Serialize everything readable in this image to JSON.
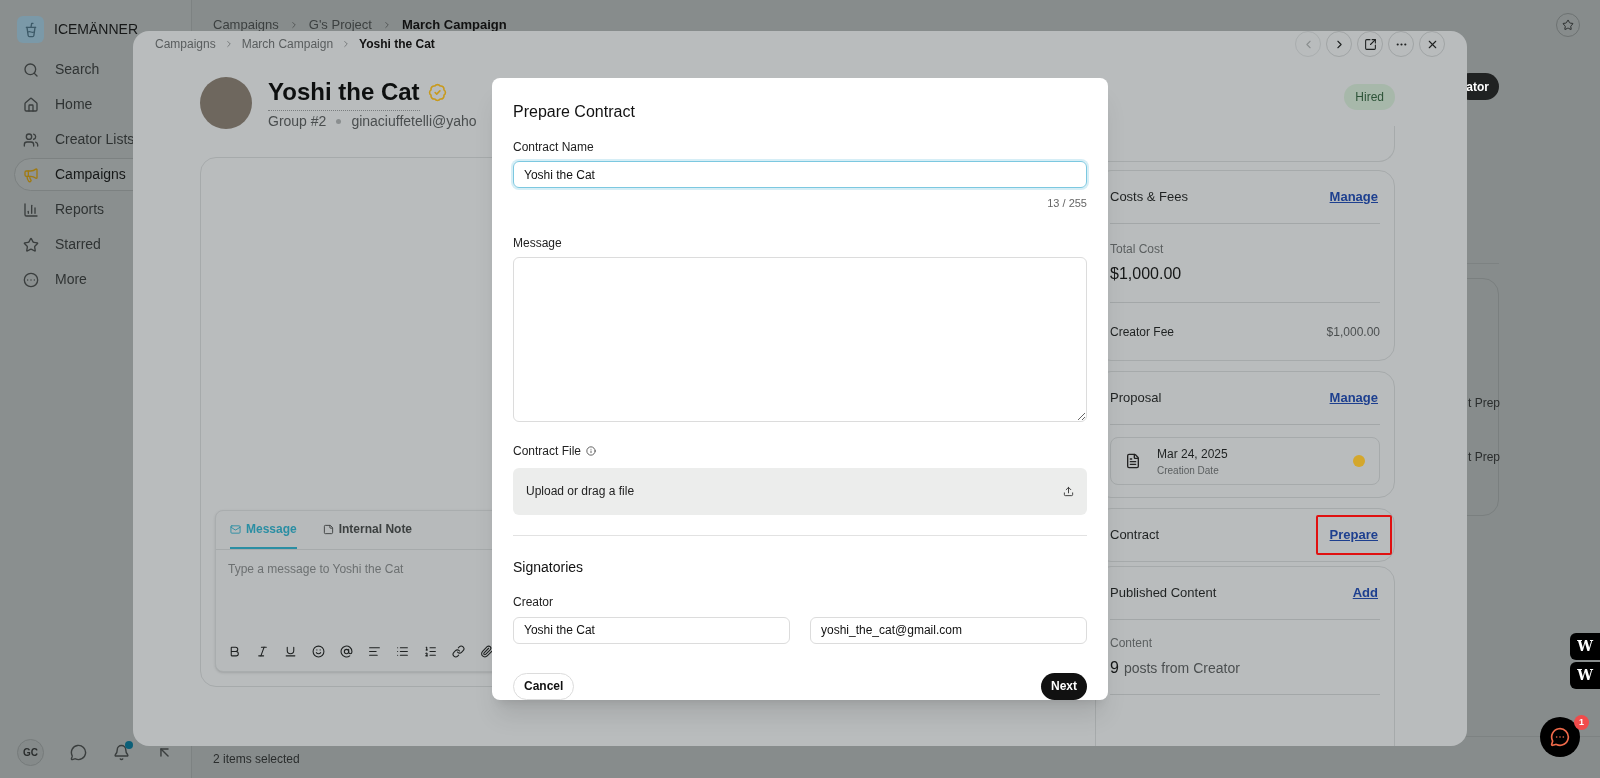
{
  "app": {
    "brand": "ICEMÄNNER",
    "nav": [
      {
        "label": "Search",
        "selected": false
      },
      {
        "label": "Home",
        "selected": false
      },
      {
        "label": "Creator Lists",
        "selected": false
      },
      {
        "label": "Campaigns",
        "selected": true
      },
      {
        "label": "Reports",
        "selected": false
      },
      {
        "label": "Starred",
        "selected": false
      },
      {
        "label": "More",
        "selected": false
      }
    ],
    "user_initials": "GC",
    "has_notification": true,
    "breadcrumbs": [
      "Campaigns",
      "G's Project",
      "March Campaign"
    ],
    "header_button": "ator",
    "background_rows": [
      "t Prep",
      "t Prep"
    ],
    "footer_text": "2 items selected",
    "side_widgets": [
      "W",
      "W"
    ],
    "chat_badge": "1"
  },
  "drawer": {
    "breadcrumbs": [
      "Campaigns",
      "March Campaign",
      "Yoshi the Cat"
    ],
    "name": "Yoshi the Cat",
    "verified": true,
    "group": "Group #2",
    "email": "ginaciuffetelli@yaho",
    "status": "Hired",
    "composer": {
      "tabs": [
        {
          "label": "Message",
          "selected": true
        },
        {
          "label": "Internal Note",
          "selected": false
        }
      ],
      "placeholder": "Type a message to Yoshi the Cat"
    },
    "sections": [
      {
        "kind": "fees",
        "title": "Costs & Fees",
        "action": "Manage",
        "highlighted": false,
        "total_label": "Total Cost",
        "total": "$1,000.00",
        "fee_label": "Creator Fee",
        "fee": "$1,000.00"
      },
      {
        "kind": "proposal",
        "title": "Proposal",
        "action": "Manage",
        "highlighted": false,
        "date": "Mar 24, 2025",
        "caption": "Creation Date",
        "color": "#d4a72c"
      },
      {
        "kind": "contract",
        "title": "Contract",
        "action": "Prepare",
        "highlighted": true
      },
      {
        "kind": "content",
        "title": "Published Content",
        "action": "Add",
        "highlighted": false,
        "content_label": "Content",
        "count": "9",
        "count_text": "posts from Creator"
      }
    ]
  },
  "dialog": {
    "title": "Prepare Contract",
    "name_label": "Contract Name",
    "name_value": "Yoshi the Cat",
    "name_focused": true,
    "counter": "13 / 255",
    "message_label": "Message",
    "file_label": "Contract File",
    "upload": "Upload or drag a file",
    "signatories": "Signatories",
    "role": "Creator",
    "signer_name": "Yoshi the Cat",
    "signer_email": "yoshi_the_cat@gmail.com",
    "cancel": "Cancel",
    "next": "Next"
  }
}
